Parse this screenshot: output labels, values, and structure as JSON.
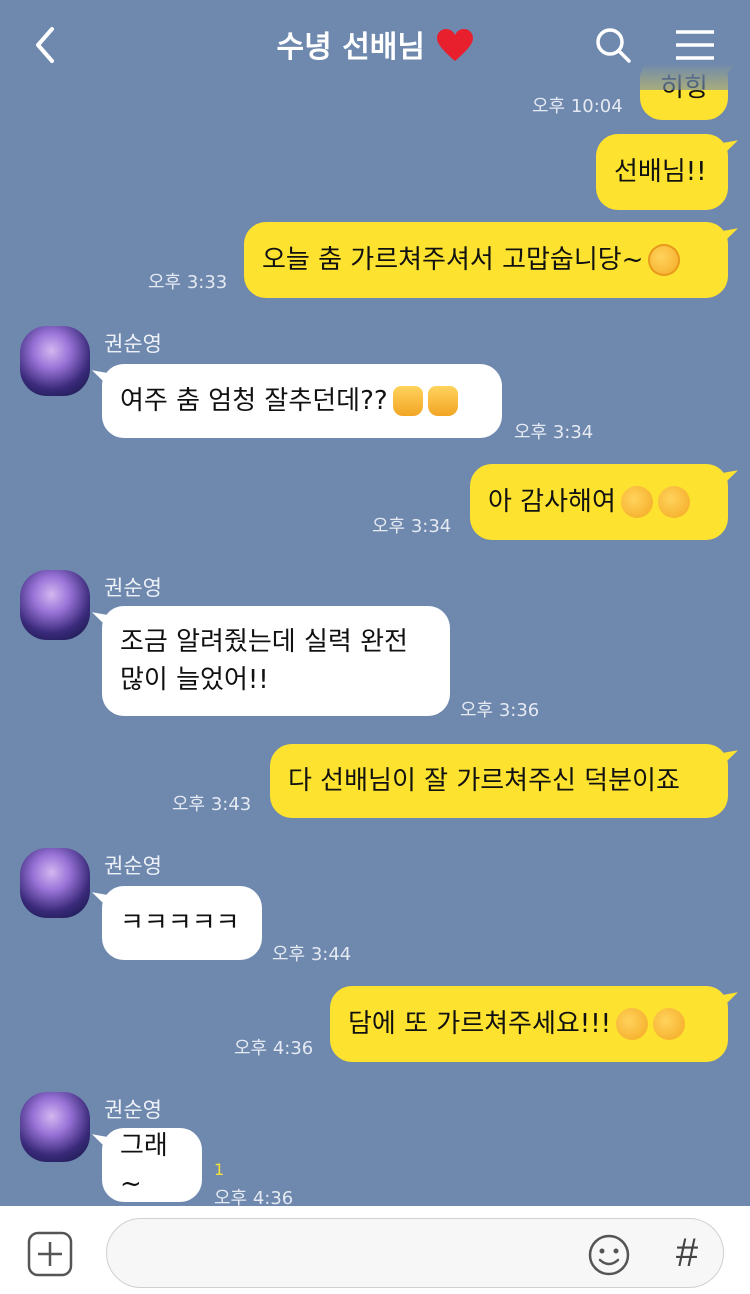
{
  "header": {
    "title": "수녕 선배님",
    "back_icon": "chevron-left-icon",
    "search_icon": "search-icon",
    "menu_icon": "menu-icon"
  },
  "colors": {
    "background": "#6e88ae",
    "my_bubble": "#fde22f",
    "their_bubble": "#ffffff"
  },
  "messages": {
    "m0": {
      "text": "히힝",
      "time": "오후 10:04"
    },
    "m1": {
      "text": "선배님!!"
    },
    "m2": {
      "text": "오늘 춤 가르쳐주셔서 고맙숩니당~",
      "time": "오후 3:33"
    },
    "m3": {
      "sender": "권순영",
      "text": "여주 춤 엄청 잘추던데??",
      "time": "오후 3:34"
    },
    "m4": {
      "text": "아 감사해여",
      "time": "오후 3:34"
    },
    "m5": {
      "sender": "권순영",
      "text_line1": "조금 알려줬는데 실력 완전",
      "text_line2": "많이 늘었어!!",
      "time": "오후 3:36"
    },
    "m6": {
      "text": "다 선배님이 잘 가르쳐주신 덕분이죠",
      "time": "오후 3:43"
    },
    "m7": {
      "sender": "권순영",
      "text": "ㅋㅋㅋㅋㅋ",
      "time": "오후 3:44"
    },
    "m8": {
      "text": "담에 또 가르쳐주세요!!!",
      "time": "오후 4:36"
    },
    "m9": {
      "sender": "권순영",
      "text": "그래~",
      "time": "오후 4:36",
      "unread": "1"
    }
  },
  "input": {
    "value": "",
    "placeholder": "",
    "hash_label": "#"
  }
}
